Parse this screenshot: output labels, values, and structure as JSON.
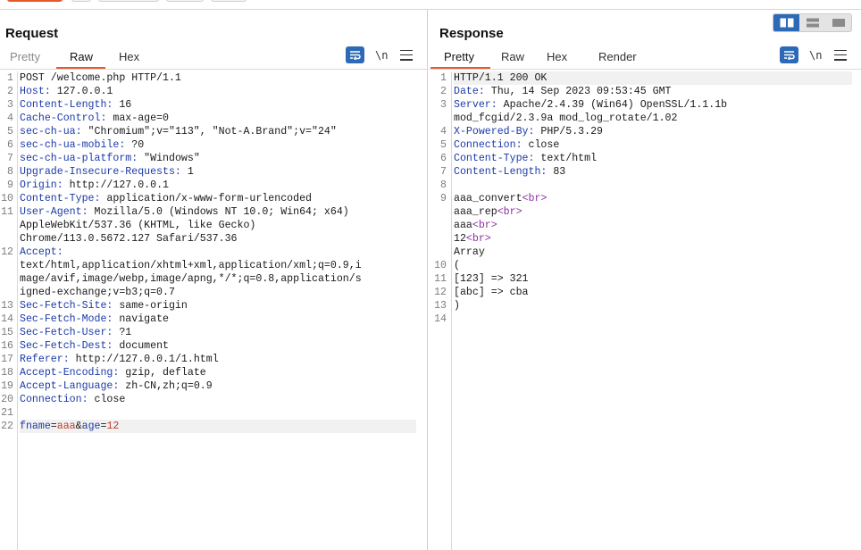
{
  "layout_toggles": [
    "split-horizontal-icon",
    "split-vertical-icon",
    "tabs-layout-icon"
  ],
  "request": {
    "title": "Request",
    "tabs": [
      {
        "label": "Pretty",
        "active": false
      },
      {
        "label": "Raw",
        "active": true
      },
      {
        "label": "Hex",
        "active": false
      }
    ],
    "newline_toggle": "\\n",
    "lines": [
      {
        "n": "1",
        "parts": [
          {
            "t": "POST /welcome.php HTTP/1.1",
            "c": ""
          }
        ]
      },
      {
        "n": "2",
        "parts": [
          {
            "t": "Host:",
            "c": "hname"
          },
          {
            "t": " 127.0.0.1",
            "c": ""
          }
        ]
      },
      {
        "n": "3",
        "parts": [
          {
            "t": "Content-Length:",
            "c": "hname"
          },
          {
            "t": " 16",
            "c": ""
          }
        ]
      },
      {
        "n": "4",
        "parts": [
          {
            "t": "Cache-Control:",
            "c": "hname"
          },
          {
            "t": " max-age=0",
            "c": ""
          }
        ]
      },
      {
        "n": "5",
        "parts": [
          {
            "t": "sec-ch-ua:",
            "c": "hname"
          },
          {
            "t": " \"Chromium\";v=\"113\", \"Not-A.Brand\";v=\"24\"",
            "c": ""
          }
        ]
      },
      {
        "n": "6",
        "parts": [
          {
            "t": "sec-ch-ua-mobile:",
            "c": "hname"
          },
          {
            "t": " ?0",
            "c": ""
          }
        ]
      },
      {
        "n": "7",
        "parts": [
          {
            "t": "sec-ch-ua-platform:",
            "c": "hname"
          },
          {
            "t": " \"Windows\"",
            "c": ""
          }
        ]
      },
      {
        "n": "8",
        "parts": [
          {
            "t": "Upgrade-Insecure-Requests:",
            "c": "hname"
          },
          {
            "t": " 1",
            "c": ""
          }
        ]
      },
      {
        "n": "9",
        "parts": [
          {
            "t": "Origin:",
            "c": "hname"
          },
          {
            "t": " http://127.0.0.1",
            "c": ""
          }
        ]
      },
      {
        "n": "10",
        "parts": [
          {
            "t": "Content-Type:",
            "c": "hname"
          },
          {
            "t": " application/x-www-form-urlencoded",
            "c": ""
          }
        ]
      },
      {
        "n": "11",
        "parts": [
          {
            "t": "User-Agent:",
            "c": "hname"
          },
          {
            "t": " Mozilla/5.0 (Windows NT 10.0; Win64; x64)",
            "c": ""
          }
        ]
      },
      {
        "n": "",
        "parts": [
          {
            "t": "AppleWebKit/537.36 (KHTML, like Gecko)",
            "c": ""
          }
        ]
      },
      {
        "n": "",
        "parts": [
          {
            "t": "Chrome/113.0.5672.127 Safari/537.36",
            "c": ""
          }
        ]
      },
      {
        "n": "12",
        "parts": [
          {
            "t": "Accept:",
            "c": "hname"
          }
        ]
      },
      {
        "n": "",
        "parts": [
          {
            "t": "text/html,application/xhtml+xml,application/xml;q=0.9,i",
            "c": ""
          }
        ]
      },
      {
        "n": "",
        "parts": [
          {
            "t": "mage/avif,image/webp,image/apng,*/*;q=0.8,application/s",
            "c": ""
          }
        ]
      },
      {
        "n": "",
        "parts": [
          {
            "t": "igned-exchange;v=b3;q=0.7",
            "c": ""
          }
        ]
      },
      {
        "n": "13",
        "parts": [
          {
            "t": "Sec-Fetch-Site:",
            "c": "hname"
          },
          {
            "t": " same-origin",
            "c": ""
          }
        ]
      },
      {
        "n": "14",
        "parts": [
          {
            "t": "Sec-Fetch-Mode:",
            "c": "hname"
          },
          {
            "t": " navigate",
            "c": ""
          }
        ]
      },
      {
        "n": "15",
        "parts": [
          {
            "t": "Sec-Fetch-User:",
            "c": "hname"
          },
          {
            "t": " ?1",
            "c": ""
          }
        ]
      },
      {
        "n": "16",
        "parts": [
          {
            "t": "Sec-Fetch-Dest:",
            "c": "hname"
          },
          {
            "t": " document",
            "c": ""
          }
        ]
      },
      {
        "n": "17",
        "parts": [
          {
            "t": "Referer:",
            "c": "hname"
          },
          {
            "t": " http://127.0.0.1/1.html",
            "c": ""
          }
        ]
      },
      {
        "n": "18",
        "parts": [
          {
            "t": "Accept-Encoding:",
            "c": "hname"
          },
          {
            "t": " gzip, deflate",
            "c": ""
          }
        ]
      },
      {
        "n": "19",
        "parts": [
          {
            "t": "Accept-Language:",
            "c": "hname"
          },
          {
            "t": " zh-CN,zh;q=0.9",
            "c": ""
          }
        ]
      },
      {
        "n": "20",
        "parts": [
          {
            "t": "Connection:",
            "c": "hname"
          },
          {
            "t": " close",
            "c": ""
          }
        ]
      },
      {
        "n": "21",
        "parts": []
      },
      {
        "n": "22",
        "hl": true,
        "parts": [
          {
            "t": "fname",
            "c": "pname"
          },
          {
            "t": "=",
            "c": ""
          },
          {
            "t": "aaa",
            "c": "pval"
          },
          {
            "t": "&",
            "c": ""
          },
          {
            "t": "age",
            "c": "pname"
          },
          {
            "t": "=",
            "c": ""
          },
          {
            "t": "12",
            "c": "pval"
          }
        ]
      }
    ]
  },
  "response": {
    "title": "Response",
    "tabs": [
      {
        "label": "Pretty",
        "active": true
      },
      {
        "label": "Raw",
        "active": false
      },
      {
        "label": "Hex",
        "active": false
      },
      {
        "label": "Render",
        "active": false
      }
    ],
    "newline_toggle": "\\n",
    "lines": [
      {
        "n": "1",
        "hl": true,
        "parts": [
          {
            "t": "HTTP/1.1 200 OK",
            "c": ""
          }
        ]
      },
      {
        "n": "2",
        "parts": [
          {
            "t": "Date:",
            "c": "hname"
          },
          {
            "t": " Thu, 14 Sep 2023 09:53:45 GMT",
            "c": ""
          }
        ]
      },
      {
        "n": "3",
        "parts": [
          {
            "t": "Server:",
            "c": "hname"
          },
          {
            "t": " Apache/2.4.39 (Win64) OpenSSL/1.1.1b",
            "c": ""
          }
        ]
      },
      {
        "n": "",
        "parts": [
          {
            "t": "mod_fcgid/2.3.9a mod_log_rotate/1.02",
            "c": ""
          }
        ]
      },
      {
        "n": "4",
        "parts": [
          {
            "t": "X-Powered-By:",
            "c": "hname"
          },
          {
            "t": " PHP/5.3.29",
            "c": ""
          }
        ]
      },
      {
        "n": "5",
        "parts": [
          {
            "t": "Connection:",
            "c": "hname"
          },
          {
            "t": " close",
            "c": ""
          }
        ]
      },
      {
        "n": "6",
        "parts": [
          {
            "t": "Content-Type:",
            "c": "hname"
          },
          {
            "t": " text/html",
            "c": ""
          }
        ]
      },
      {
        "n": "7",
        "parts": [
          {
            "t": "Content-Length:",
            "c": "hname"
          },
          {
            "t": " 83",
            "c": ""
          }
        ]
      },
      {
        "n": "8",
        "parts": []
      },
      {
        "n": "9",
        "parts": [
          {
            "t": "aaa_convert",
            "c": ""
          },
          {
            "t": "<br>",
            "c": "tag"
          }
        ]
      },
      {
        "n": "",
        "parts": [
          {
            "t": "aaa_rep",
            "c": ""
          },
          {
            "t": "<br>",
            "c": "tag"
          }
        ]
      },
      {
        "n": "",
        "parts": [
          {
            "t": "aaa",
            "c": ""
          },
          {
            "t": "<br>",
            "c": "tag"
          }
        ]
      },
      {
        "n": "",
        "parts": [
          {
            "t": "12",
            "c": ""
          },
          {
            "t": "<br>",
            "c": "tag"
          }
        ]
      },
      {
        "n": "",
        "parts": [
          {
            "t": "Array",
            "c": ""
          }
        ]
      },
      {
        "n": "10",
        "parts": [
          {
            "t": "(",
            "c": ""
          }
        ]
      },
      {
        "n": "11",
        "parts": [
          {
            "t": "[123] => 321",
            "c": ""
          }
        ]
      },
      {
        "n": "12",
        "parts": [
          {
            "t": "[abc] => cba",
            "c": ""
          }
        ]
      },
      {
        "n": "13",
        "parts": [
          {
            "t": ")",
            "c": ""
          }
        ]
      },
      {
        "n": "14",
        "parts": []
      }
    ]
  }
}
